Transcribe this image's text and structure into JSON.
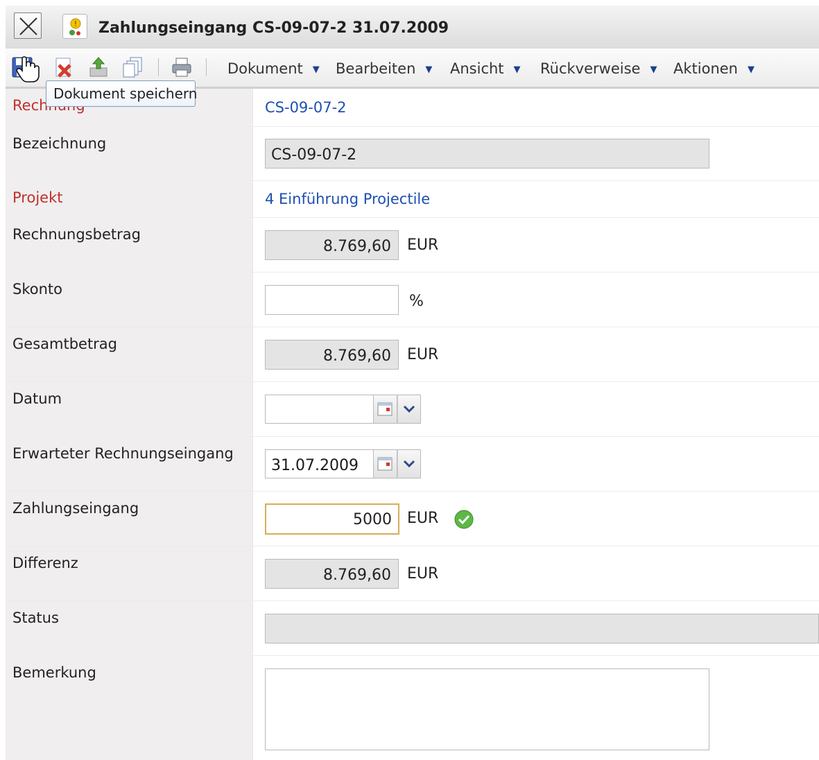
{
  "window": {
    "title": "Zahlungseingang CS-09-07-2 31.07.2009"
  },
  "toolbar": {
    "icons": [
      "save-icon",
      "delete-icon",
      "upload-icon",
      "copy-icon",
      "print-icon"
    ],
    "menus": [
      {
        "label": "Dokument"
      },
      {
        "label": "Bearbeiten"
      },
      {
        "label": "Ansicht"
      },
      {
        "label": "Rückverweise"
      },
      {
        "label": "Aktionen"
      }
    ],
    "tooltip": "Dokument speichern"
  },
  "form": {
    "rechnung": {
      "label": "Rechnung",
      "value": "CS-09-07-2"
    },
    "bezeichnung": {
      "label": "Bezeichnung",
      "value": "CS-09-07-2"
    },
    "projekt": {
      "label": "Projekt",
      "value": "4 Einführung Projectile"
    },
    "rechnungsbetrag": {
      "label": "Rechnungsbetrag",
      "value": "8.769,60",
      "unit": "EUR"
    },
    "skonto": {
      "label": "Skonto",
      "value": "",
      "unit": "%"
    },
    "gesamtbetrag": {
      "label": "Gesamtbetrag",
      "value": "8.769,60",
      "unit": "EUR"
    },
    "datum": {
      "label": "Datum",
      "value": ""
    },
    "erwarteter": {
      "label": "Erwarteter Rechnungseingang",
      "value": "31.07.2009"
    },
    "zahlungseingang": {
      "label": "Zahlungseingang",
      "value": "5000",
      "unit": "EUR",
      "status_icon": "check-icon"
    },
    "differenz": {
      "label": "Differenz",
      "value": "8.769,60",
      "unit": "EUR"
    },
    "status": {
      "label": "Status",
      "value": ""
    },
    "bemerkung": {
      "label": "Bemerkung",
      "value": ""
    }
  },
  "colors": {
    "required_label": "#c0302c",
    "link": "#1d50b0",
    "focus_border": "#d7ad58",
    "readonly_bg": "#e4e4e4",
    "label_bg": "#f0eeee"
  }
}
